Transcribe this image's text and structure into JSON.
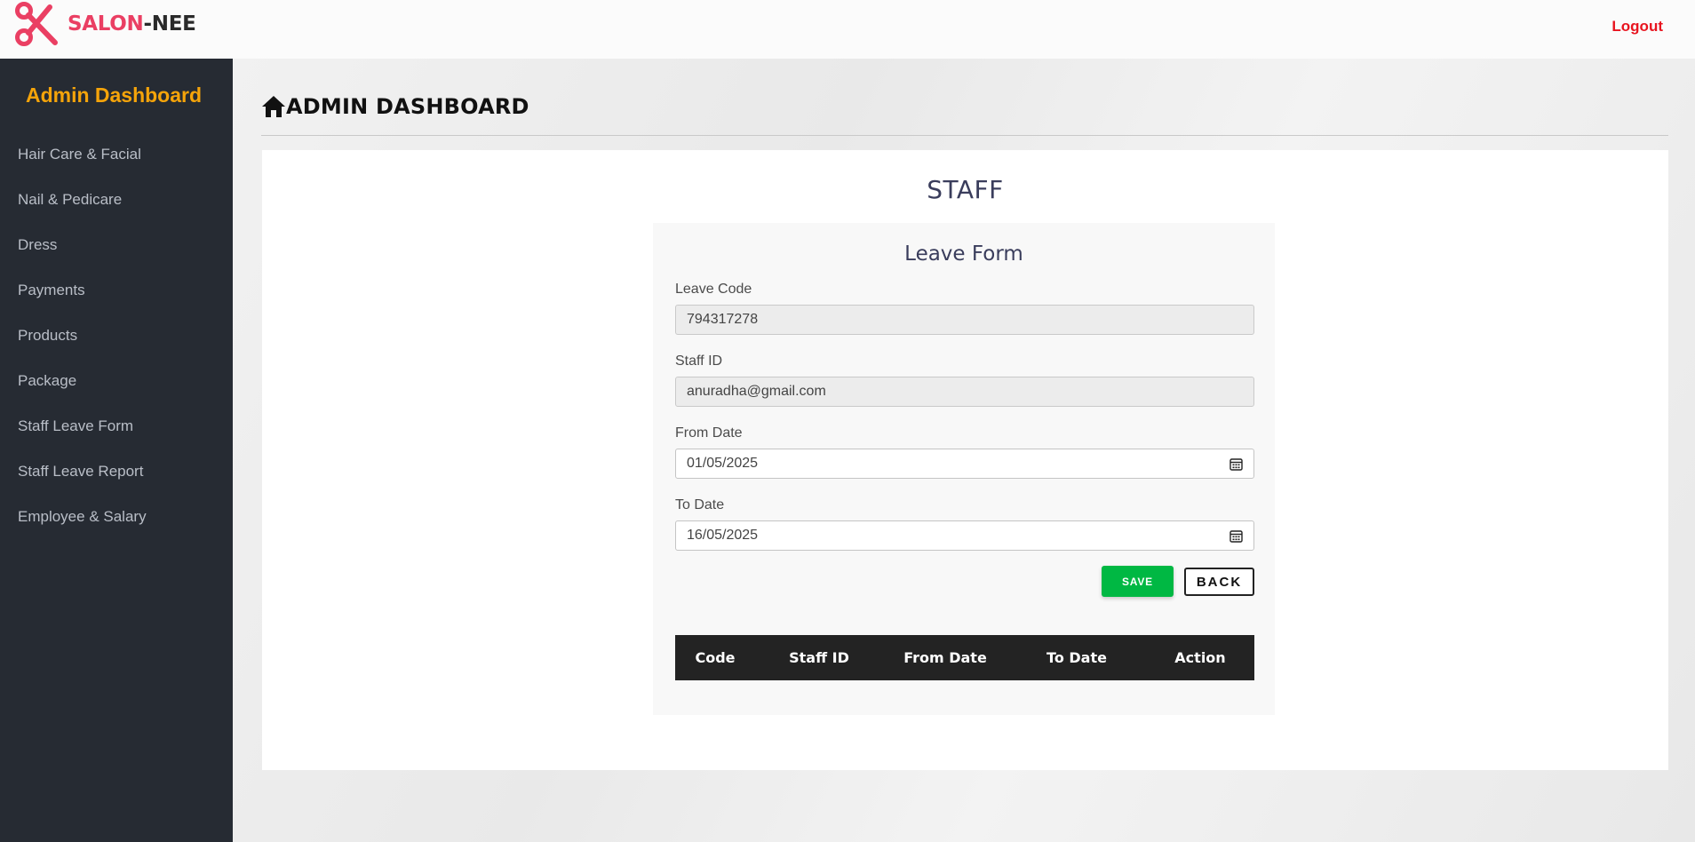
{
  "brand": {
    "name_part1": "SALON",
    "name_part2": "-NEE",
    "logo_icon": "scissors-icon",
    "color": "#ea3f63"
  },
  "header": {
    "logout_label": "Logout"
  },
  "sidebar": {
    "title": "Admin Dashboard",
    "items": [
      {
        "label": "Hair Care & Facial"
      },
      {
        "label": "Nail & Pedicare"
      },
      {
        "label": "Dress"
      },
      {
        "label": "Payments"
      },
      {
        "label": "Products"
      },
      {
        "label": "Package"
      },
      {
        "label": "Staff Leave Form"
      },
      {
        "label": "Staff Leave Report"
      },
      {
        "label": "Employee & Salary"
      }
    ]
  },
  "page": {
    "title": "ADMIN DASHBOARD",
    "icon": "home-icon"
  },
  "section": {
    "title": "STAFF"
  },
  "form": {
    "title": "Leave Form",
    "leave_code": {
      "label": "Leave Code",
      "value": "794317278"
    },
    "staff_id": {
      "label": "Staff ID",
      "value": "anuradha@gmail.com"
    },
    "from_date": {
      "label": "From Date",
      "value": "01/05/2025"
    },
    "to_date": {
      "label": "To Date",
      "value": "16/05/2025"
    },
    "save_label": "SAVE",
    "back_label": "BACK"
  },
  "table": {
    "headers": [
      "Code",
      "Staff ID",
      "From Date",
      "To Date",
      "Action"
    ],
    "rows": []
  },
  "colors": {
    "accent_sidebar_title": "#f5a40a",
    "logout": "#e8141f",
    "save_button": "#00b843",
    "sidebar_bg": "#262b33"
  }
}
